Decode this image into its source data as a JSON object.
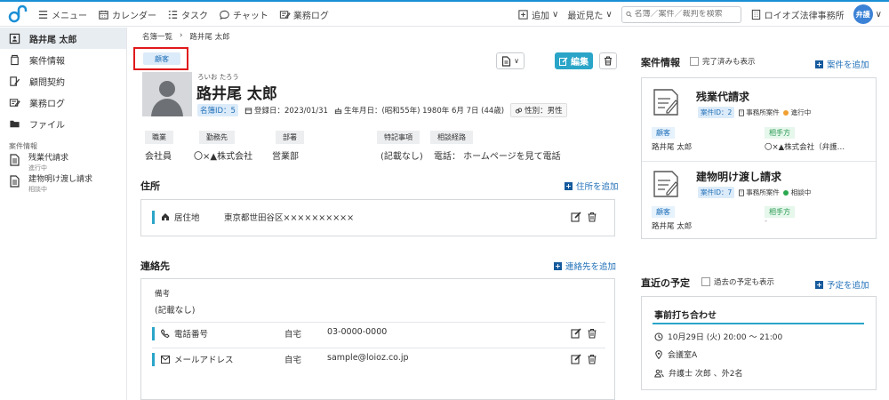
{
  "header": {
    "nav": [
      {
        "icon": "menu-icon",
        "label": "メニュー"
      },
      {
        "icon": "calendar-icon",
        "label": "カレンダー"
      },
      {
        "icon": "task-list-icon",
        "label": "タスク"
      },
      {
        "icon": "chat-icon",
        "label": "チャット"
      },
      {
        "icon": "work-log-icon",
        "label": "業務ログ"
      }
    ],
    "add_label": "追加",
    "recent_label": "最近見た",
    "search_placeholder": "名簿／案件／裁判を検索",
    "office_name": "ロイオズ法律事務所",
    "avatar_text": "弁護"
  },
  "sidebar": {
    "items": [
      {
        "icon": "contact-card-icon",
        "label": "路井尾 太郎",
        "active": true
      },
      {
        "icon": "matter-icon",
        "label": "案件情報"
      },
      {
        "icon": "contract-icon",
        "label": "顧問契約"
      },
      {
        "icon": "work-log-icon",
        "label": "業務ログ"
      },
      {
        "icon": "folder-icon",
        "label": "ファイル"
      }
    ],
    "section_label": "案件情報",
    "matters": [
      {
        "title": "残業代請求",
        "status": "進行中"
      },
      {
        "title": "建物明け渡し請求",
        "status": "相談中"
      }
    ]
  },
  "breadcrumb": {
    "parent": "名簿一覧",
    "sep": "›",
    "current": "路井尾 太郎"
  },
  "profile": {
    "badge": "顧客",
    "kana": "ろいお たろう",
    "name": "路井尾 太郎",
    "meibo_id": "名簿ID：5",
    "registered": "登録日：2023/01/31",
    "birthday": "生年月日：(昭和55年) 1980年 6月 7日 (44歳)",
    "gender": "性別：男性",
    "edit_label": "編集"
  },
  "attributes": {
    "headers": [
      "職業",
      "勤務先",
      "部署",
      "特記事項",
      "相談経路"
    ],
    "values": [
      "会社員",
      "〇×▲株式会社",
      "営業部",
      "(記載なし)",
      "電話： ホームページを見て電話"
    ]
  },
  "address": {
    "title": "住所",
    "add_label": "住所を追加",
    "rows": [
      {
        "label": "居住地",
        "value": "東京都世田谷区××××××××××"
      }
    ]
  },
  "contact": {
    "title": "連絡先",
    "add_label": "連絡先を追加",
    "note_label": "備考",
    "note_value": "(記載なし)",
    "rows": [
      {
        "label": "電話番号",
        "type": "自宅",
        "value": "03-0000-0000"
      },
      {
        "label": "メールアドレス",
        "type": "自宅",
        "value": "sample@loioz.co.jp"
      }
    ]
  },
  "matters_panel": {
    "title": "案件情報",
    "show_done_label": "完了済みも表示",
    "add_label": "案件を追加",
    "cards": [
      {
        "title": "残業代請求",
        "id": "案件ID：2",
        "office": "事務所案件",
        "status": "進行中",
        "status_color": "#f0a030",
        "client_label": "顧客",
        "client": "路井尾 太郎",
        "opponent_label": "相手方",
        "opponent": "〇×▲株式会社（弁護…"
      },
      {
        "title": "建物明け渡し請求",
        "id": "案件ID：7",
        "office": "事務所案件",
        "status": "相談中",
        "status_color": "#2aa84e",
        "client_label": "顧客",
        "client": "路井尾 太郎",
        "opponent_label": "相手方",
        "opponent": "-"
      }
    ]
  },
  "schedule": {
    "title": "直近の予定",
    "show_past_label": "過去の予定も表示",
    "add_label": "予定を追加",
    "event": {
      "title": "事前打ち合わせ",
      "time": "10月29日 (火) 20:00 ～ 21:00",
      "place": "会議室A",
      "people": "弁護士 次郎 、外2名"
    }
  },
  "colors": {
    "accent": "#2aa5c8",
    "brand_blue": "#1b8fd6",
    "link": "#1f6fb8",
    "highlight_red": "#e0191b"
  }
}
